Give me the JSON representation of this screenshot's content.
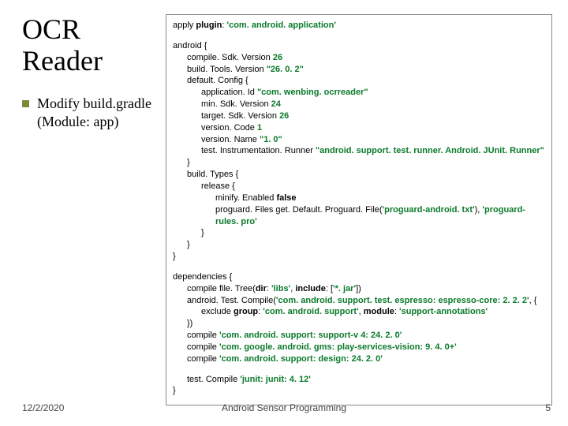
{
  "title": "OCR Reader",
  "bullet": "Modify build.gradle (Module: app)",
  "code": {
    "l0_a": "apply ",
    "l0_b": "plugin",
    "l0_c": ": ",
    "l0_d": "'com. android. application'",
    "l1": "android {",
    "l2_a": "compile. Sdk. Version ",
    "l2_b": "26",
    "l3_a": "build. Tools. Version ",
    "l3_b": "\"26. 0. 2\"",
    "l4": "default. Config {",
    "l5_a": "application. Id ",
    "l5_b": "\"com. wenbing. ocrreader\"",
    "l6_a": "min. Sdk. Version ",
    "l6_b": "24",
    "l7_a": "target. Sdk. Version ",
    "l7_b": "26",
    "l8_a": "version. Code ",
    "l8_b": "1",
    "l9_a": "version. Name ",
    "l9_b": "\"1. 0\"",
    "l10_a": "test. Instrumentation. Runner ",
    "l10_b": "\"android. support. test. runner. Android. JUnit. Runner\"",
    "l11": "}",
    "l12": "build. Types {",
    "l13": "release {",
    "l14_a": "minify. Enabled ",
    "l14_b": "false",
    "l15_a": "proguard. Files get. Default. Proguard. File(",
    "l15_b": "'proguard-android. txt'",
    "l15_c": "), ",
    "l15_d": "'proguard-rules. pro'",
    "l16": "}",
    "l17": "}",
    "l18": "}",
    "d0": "dependencies {",
    "d1_a": "compile file. Tree(",
    "d1_b": "dir",
    "d1_c": ": ",
    "d1_d": "'libs'",
    "d1_e": ", ",
    "d1_f": "include",
    "d1_g": ": [",
    "d1_h": "'*. jar'",
    "d1_i": "])",
    "d2_a": "android. Test. Compile(",
    "d2_b": "'com. android. support. test. espresso: espresso-core: 2. 2. 2'",
    "d2_c": ", {",
    "d3_a": "exclude ",
    "d3_b": "group",
    "d3_c": ": ",
    "d3_d": "'com. android. support'",
    "d3_e": ", ",
    "d3_f": "module",
    "d3_g": ": ",
    "d3_h": "'support-annotations'",
    "d4": "})",
    "d5_a": "compile ",
    "d5_b": "'com. android. support: support-v 4: 24. 2. 0'",
    "d6_a": "compile ",
    "d6_b": "'com. google. android. gms: play-services-vision: 9. 4. 0+'",
    "d7_a": "compile ",
    "d7_b": "'com. android. support: design: 24. 2. 0'",
    "d8_a": "test. Compile ",
    "d8_b": "'junit: junit: 4. 12'",
    "d9": "}"
  },
  "footer": {
    "date": "12/2/2020",
    "title": "Android Sensor Programming",
    "page": "5"
  }
}
